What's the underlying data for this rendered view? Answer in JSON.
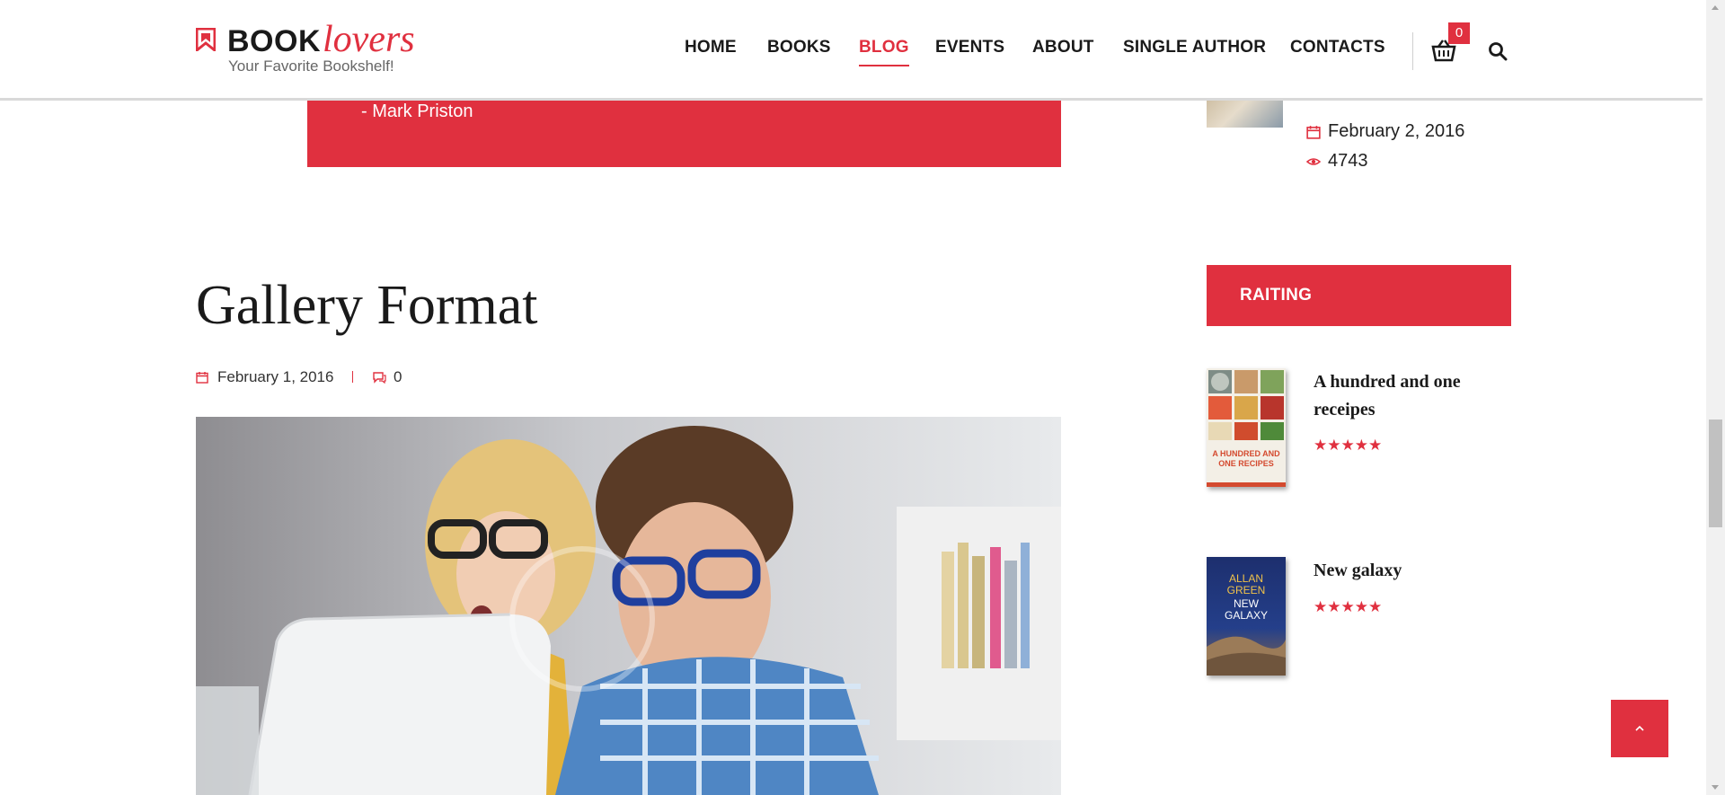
{
  "header": {
    "logo": {
      "bold": "BOOK",
      "italic": "lovers",
      "tagline": "Your Favorite Bookshelf!"
    },
    "nav": [
      {
        "label": "HOME",
        "active": false
      },
      {
        "label": "BOOKS",
        "active": false
      },
      {
        "label": "BLOG",
        "active": true
      },
      {
        "label": "EVENTS",
        "active": false
      },
      {
        "label": "ABOUT",
        "active": false
      },
      {
        "label": "SINGLE AUTHOR",
        "active": false
      },
      {
        "label": "CONTACTS",
        "active": false
      }
    ],
    "cart_count": "0",
    "icons": {
      "cart": "basket-icon",
      "search": "search-icon"
    }
  },
  "quote": {
    "author": "- Mark Priston"
  },
  "post": {
    "title": "Gallery Format",
    "date": "February 1, 2016",
    "comments": "0"
  },
  "sidebar": {
    "recent": {
      "date": "February 2, 2016",
      "views": "4743"
    },
    "rating_widget": {
      "title": "RAITING",
      "items": [
        {
          "title": "A hundred and one receipes",
          "stars": "★★★★★",
          "cover_text": "A HUNDRED AND ONE RECIPES"
        },
        {
          "title": "New galaxy",
          "stars": "★★★★★",
          "cover_text": "ALLAN GREEN NEW GALAXY"
        }
      ]
    }
  },
  "colors": {
    "accent": "#e0303f",
    "text": "#1a1a1a"
  }
}
